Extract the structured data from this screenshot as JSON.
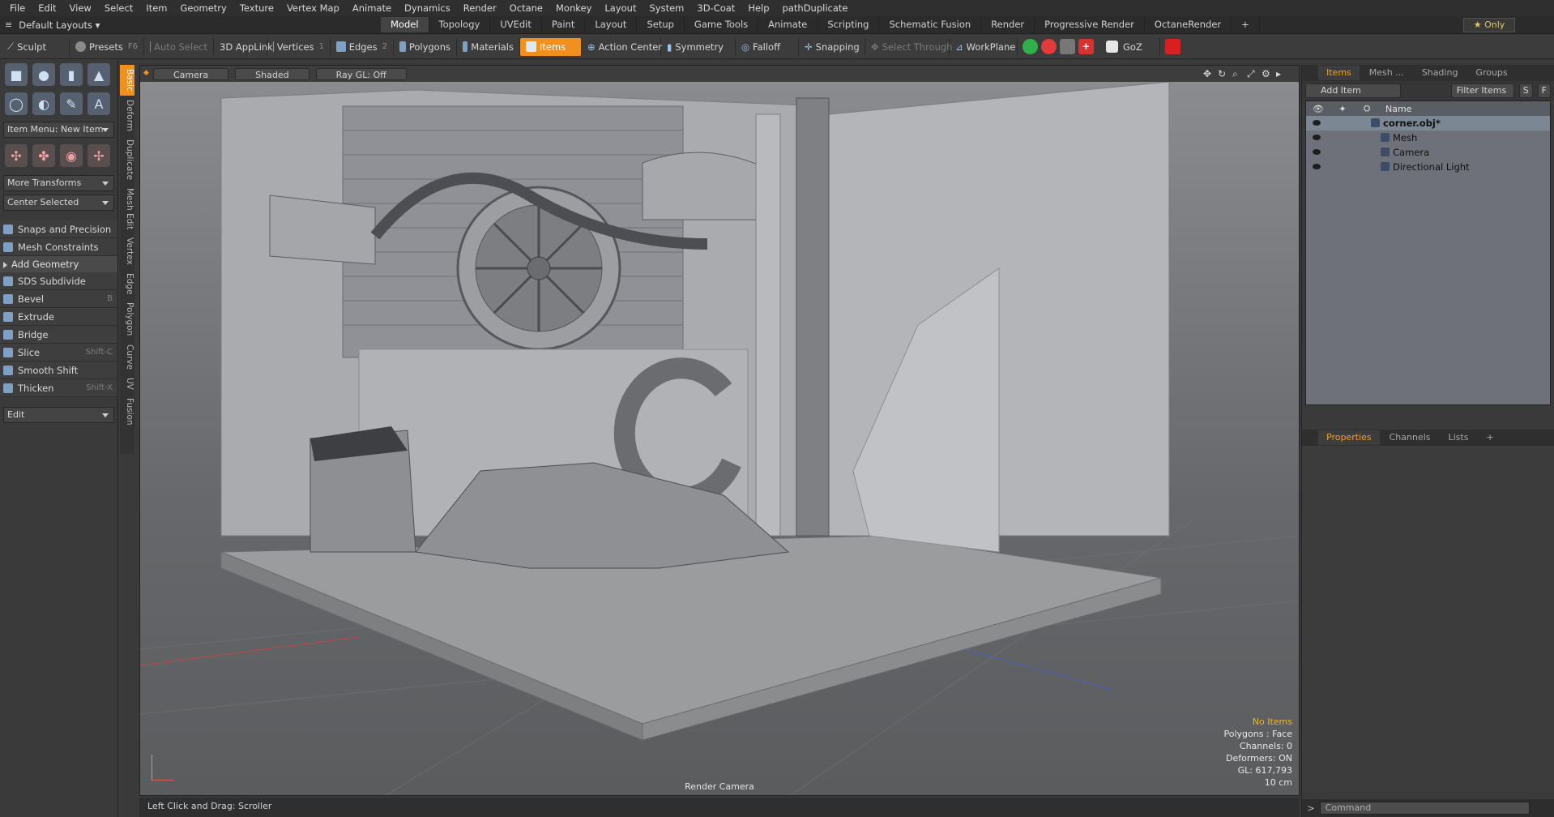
{
  "menubar": [
    "File",
    "Edit",
    "View",
    "Select",
    "Item",
    "Geometry",
    "Texture",
    "Vertex Map",
    "Animate",
    "Dynamics",
    "Render",
    "Octane",
    "Monkey",
    "Layout",
    "System",
    "3D-Coat",
    "Help",
    "pathDuplicate"
  ],
  "layoutbar": {
    "layouts_label": "Default Layouts",
    "tabs": [
      "Model",
      "Topology",
      "UVEdit",
      "Paint",
      "Layout",
      "Setup",
      "Game Tools",
      "Animate",
      "Scripting",
      "Schematic Fusion",
      "Render",
      "Progressive Render",
      "OctaneRender"
    ],
    "active_tab": "Model",
    "add_tab": "+",
    "only_label": "Only",
    "only_star": "★"
  },
  "toolbar": {
    "sculpt": "Sculpt",
    "presets": "Presets",
    "presets_key": "F6",
    "auto_select": "Auto Select",
    "applink": "3D AppLink",
    "vertices": "Vertices",
    "vertices_key": "1",
    "edges": "Edges",
    "edges_key": "2",
    "polygons": "Polygons",
    "materials": "Materials",
    "items": "Items",
    "action_center": "Action Center",
    "symmetry": "Symmetry",
    "falloff": "Falloff",
    "snapping": "Snapping",
    "select_through": "Select Through",
    "workplane": "WorkPlane",
    "goz": "GoZ",
    "badge_colors": [
      "#2fb04a",
      "#e03a3a",
      "#c8c8c8",
      "#d93030",
      "#ffffff",
      "#d92020"
    ]
  },
  "vtabs": [
    "Basic",
    "Deform",
    "Duplicate",
    "Mesh Edit",
    "Vertex",
    "Edge",
    "Polygon",
    "Curve",
    "UV",
    "Fusion"
  ],
  "leftpanel": {
    "item_menu": "Item Menu: New Item",
    "more_transforms": "More Transforms",
    "center_selected": "Center Selected",
    "snaps": "Snaps and Precision",
    "mesh_constraints": "Mesh Constraints",
    "add_geometry": "Add Geometry",
    "tools": [
      {
        "label": "SDS Subdivide",
        "key": ""
      },
      {
        "label": "Bevel",
        "key": "B"
      },
      {
        "label": "Extrude",
        "key": ""
      },
      {
        "label": "Bridge",
        "key": ""
      },
      {
        "label": "Slice",
        "key": "Shift-C"
      },
      {
        "label": "Smooth Shift",
        "key": ""
      },
      {
        "label": "Thicken",
        "key": "Shift-X"
      }
    ],
    "edit_dropdown": "Edit"
  },
  "viewport": {
    "camera": "Camera",
    "shaded": "Shaded",
    "raygl": "Ray GL: Off",
    "render_camera": "Render Camera",
    "info": {
      "no_items": "No Items",
      "polygons": "Polygons : Face",
      "channels": "Channels: 0",
      "deformers": "Deformers: ON",
      "gl": "GL: 617,793",
      "scale": "10 cm"
    }
  },
  "status": {
    "text": "Left Click and Drag:  Scroller"
  },
  "itemlist": {
    "tabs": [
      "Items",
      "Mesh ...",
      "Shading",
      "Groups"
    ],
    "add_item": "Add Item",
    "filter_items": "Filter Items",
    "col_name": "Name",
    "btn_s": "S",
    "btn_f": "F",
    "items": [
      {
        "label": "corner.obj*",
        "bold": true,
        "indent": 0
      },
      {
        "label": "Mesh",
        "bold": false,
        "indent": 1
      },
      {
        "label": "Camera",
        "bold": false,
        "indent": 1
      },
      {
        "label": "Directional Light",
        "bold": false,
        "indent": 1
      }
    ]
  },
  "props": {
    "tabs": [
      "Properties",
      "Channels",
      "Lists",
      "+"
    ]
  },
  "command": {
    "prompt": ">",
    "placeholder": "Command"
  }
}
